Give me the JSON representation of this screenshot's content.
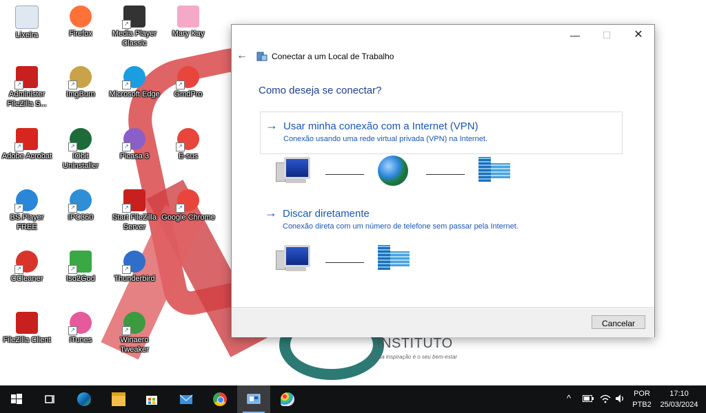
{
  "desktop": {
    "icons": [
      {
        "label": "Lixeira",
        "icon": "recycle-bin-icon",
        "color": "#dfe8f0"
      },
      {
        "label": "Firefox",
        "icon": "firefox-icon",
        "color": "#ff7139"
      },
      {
        "label": "Media Player Classic",
        "icon": "media-player-icon",
        "color": "#333333"
      },
      {
        "label": "Mary Kay",
        "icon": "folder-icon",
        "color": "#f4a9c8"
      },
      {
        "label": "Administer FileZilla S...",
        "icon": "filezilla-server-icon",
        "color": "#c8201e"
      },
      {
        "label": "ImgBurn",
        "icon": "imgburn-icon",
        "color": "#c9a24a"
      },
      {
        "label": "Microsoft Edge",
        "icon": "edge-icon",
        "color": "#1b9de2"
      },
      {
        "label": "GmdPro",
        "icon": "chrome-icon",
        "color": "#e8453c"
      },
      {
        "label": "Adobe Acrobat",
        "icon": "acrobat-icon",
        "color": "#d7261e"
      },
      {
        "label": "IObit Uninstaller",
        "icon": "iobit-icon",
        "color": "#1e6b3a"
      },
      {
        "label": "Picasa 3",
        "icon": "picasa-icon",
        "color": "#8a5fc8"
      },
      {
        "label": "E-sus",
        "icon": "chrome-icon",
        "color": "#e8453c"
      },
      {
        "label": "BS.Player FREE",
        "icon": "bsplayer-icon",
        "color": "#2a86d8"
      },
      {
        "label": "IPC360",
        "icon": "ipc360-icon",
        "color": "#2e8fd6"
      },
      {
        "label": "Start FileZilla Server",
        "icon": "filezilla-server-icon",
        "color": "#c8201e"
      },
      {
        "label": "Google Chrome",
        "icon": "chrome-icon",
        "color": "#e8453c"
      },
      {
        "label": "CCleaner",
        "icon": "ccleaner-icon",
        "color": "#d9342b"
      },
      {
        "label": "Iso2God",
        "icon": "iso2god-icon",
        "color": "#3aa845"
      },
      {
        "label": "Thunderbird",
        "icon": "thunderbird-icon",
        "color": "#2f6ec9"
      },
      {
        "label": "FileZilla Client",
        "icon": "filezilla-client-icon",
        "color": "#c8201e"
      },
      {
        "label": "iTunes",
        "icon": "itunes-icon",
        "color": "#e65a9b"
      },
      {
        "label": "Winaero Tweaker",
        "icon": "winaero-icon",
        "color": "#3c9b3f"
      }
    ],
    "wallpaper_logo": {
      "text": "INSTITUTO",
      "tagline": "Nossa inspiração é o seu bem-estar"
    }
  },
  "dialog": {
    "title": "Conectar a um Local de Trabalho",
    "window_controls": {
      "minimize": "—",
      "maximize": "☐",
      "close": "✕"
    },
    "back_arrow": "←",
    "question": "Como deseja se conectar?",
    "options": [
      {
        "arrow": "→",
        "title": "Usar minha conexão com a Internet (VPN)",
        "description": "Conexão usando uma rede virtual privada (VPN) na Internet."
      },
      {
        "arrow": "→",
        "title": "Discar diretamente",
        "description": "Conexão direta com um número de telefone sem passar pela Internet."
      }
    ],
    "cancel_label": "Cancelar",
    "accent_color": "#1a56b8"
  },
  "taskbar": {
    "apps": [
      {
        "name": "start-button",
        "icon": "windows-logo-icon"
      },
      {
        "name": "task-view-button",
        "icon": "task-view-icon"
      },
      {
        "name": "edge-taskbar",
        "icon": "edge-icon"
      },
      {
        "name": "file-explorer-taskbar",
        "icon": "folder-icon"
      },
      {
        "name": "store-taskbar",
        "icon": "store-icon"
      },
      {
        "name": "mail-taskbar",
        "icon": "mail-icon"
      },
      {
        "name": "chrome-taskbar",
        "icon": "chrome-icon"
      },
      {
        "name": "workplace-wizard-taskbar",
        "icon": "network-wizard-icon",
        "active": true
      },
      {
        "name": "paint-taskbar",
        "icon": "paint-icon"
      }
    ],
    "tray": {
      "chevron": "^",
      "language_line1": "POR",
      "language_line2": "PTB2",
      "time": "17:10",
      "date": "25/03/2024"
    }
  }
}
